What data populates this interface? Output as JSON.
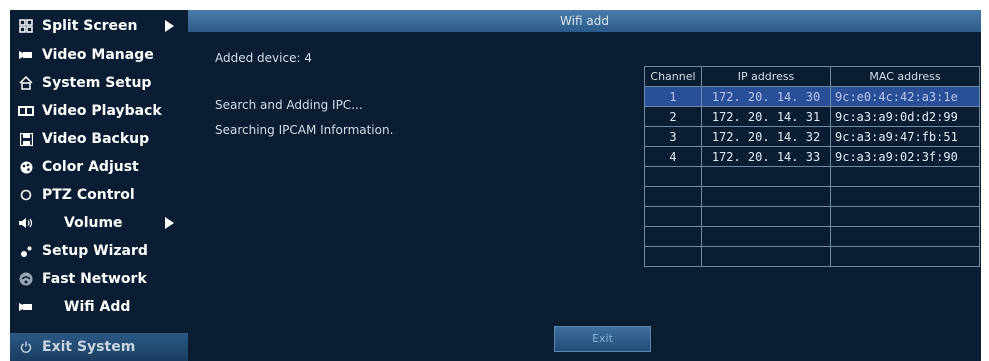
{
  "sidebar": {
    "items": [
      {
        "label": "Split Screen",
        "icon": "split-screen-icon",
        "submenu": true
      },
      {
        "label": "Video Manage",
        "icon": "camera-icon",
        "submenu": false
      },
      {
        "label": "System Setup",
        "icon": "home-icon",
        "submenu": false
      },
      {
        "label": "Video Playback",
        "icon": "playback-icon",
        "submenu": false
      },
      {
        "label": "Video Backup",
        "icon": "floppy-disk-icon",
        "submenu": false
      },
      {
        "label": "Color Adjust",
        "icon": "palette-icon",
        "submenu": false
      },
      {
        "label": "PTZ Control",
        "icon": "ptz-icon",
        "submenu": false
      },
      {
        "label": "Volume",
        "icon": "speaker-icon",
        "submenu": true
      },
      {
        "label": "Setup Wizard",
        "icon": "wizard-icon",
        "submenu": false
      },
      {
        "label": "Fast Network",
        "icon": "network-icon",
        "submenu": false
      },
      {
        "label": "Wifi Add",
        "icon": "camera-icon",
        "submenu": false
      },
      {
        "label": "Exit System",
        "icon": "power-icon",
        "submenu": false,
        "active": true
      }
    ]
  },
  "panel": {
    "title": "Wifi add",
    "added_device": "Added device: 4",
    "status_line1": "Search and Adding IPC...",
    "status_line2": "Searching IPCAM Information.",
    "exit_label": "Exit"
  },
  "table": {
    "headers": [
      "Channel",
      "IP address",
      "MAC address"
    ],
    "rows": [
      [
        "1",
        "172. 20. 14. 30",
        "9c:e0:4c:42:a3:1e"
      ],
      [
        "2",
        "172. 20. 14. 31",
        "9c:a3:a9:0d:d2:99"
      ],
      [
        "3",
        "172. 20. 14. 32",
        "9c:a3:a9:47:fb:51"
      ],
      [
        "4",
        "172. 20. 14. 33",
        "9c:a3:a9:02:3f:90"
      ],
      [
        "",
        "",
        ""
      ],
      [
        "",
        "",
        ""
      ],
      [
        "",
        "",
        ""
      ],
      [
        "",
        "",
        ""
      ],
      [
        "",
        "",
        ""
      ]
    ],
    "selected_row": 0
  },
  "colors": {
    "background": "#0b1d33",
    "titlebar": "#3a6b99",
    "selected_row": "#2a4f99",
    "active_menu": "#2b5a86"
  }
}
